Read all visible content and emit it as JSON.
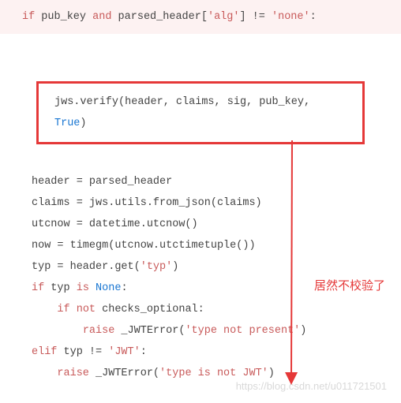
{
  "top_if": {
    "kw_if": "if",
    "t1": " pub_key ",
    "kw_and": "and",
    "t2": " parsed_header[",
    "s_alg": "'alg'",
    "t3": "] != ",
    "s_none": "'none'",
    "t4": ":"
  },
  "verify": {
    "prefix": "jws.verify(header, claims, sig, pub_key, ",
    "true": "True",
    "suffix": ")"
  },
  "lines": {
    "l1": "header = parsed_header",
    "l2": "claims = jws.utils.from_json(claims)",
    "blank1": "",
    "l3": "utcnow = datetime.utcnow()",
    "l4": "now = timegm(utcnow.utctimetuple())",
    "blank2": "",
    "l5a": "typ = header.get(",
    "l5b": "'typ'",
    "l5c": ")",
    "l6a": "if",
    "l6b": " typ ",
    "l6c": "is",
    "l6d": " ",
    "l6e": "None",
    "l6f": ":",
    "l7a": "    ",
    "l7b": "if",
    "l7c": " ",
    "l7d": "not",
    "l7e": " checks_optional:",
    "l8a": "        ",
    "l8b": "raise",
    "l8c": " _JWTError(",
    "l8d": "'type not present'",
    "l8e": ")",
    "l9a": "elif",
    "l9b": " typ != ",
    "l9c": "'JWT'",
    "l9d": ":",
    "l10a": "    ",
    "l10b": "raise",
    "l10c": " _JWTError(",
    "l10d": "'type is not JWT'",
    "l10e": ")"
  },
  "annotation": "居然不校验了",
  "watermark": "https://blog.csdn.net/u011721501"
}
